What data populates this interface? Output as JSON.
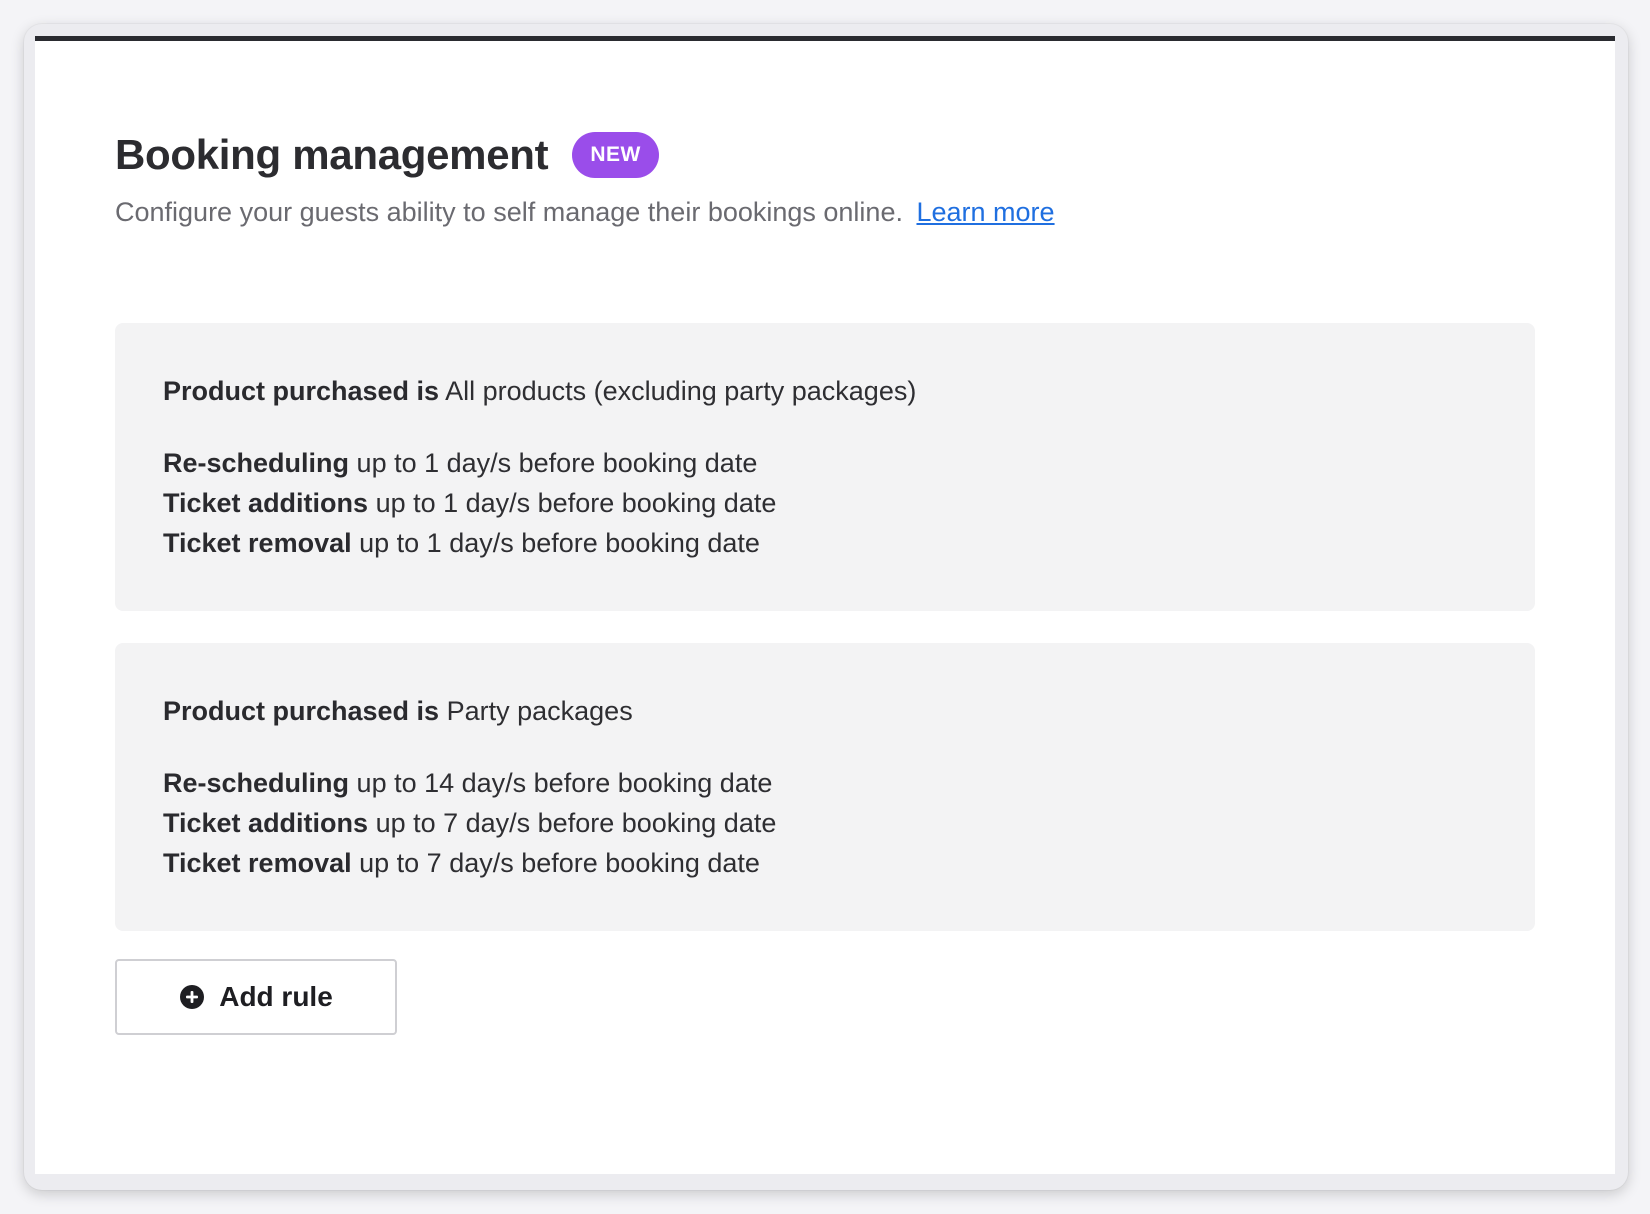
{
  "header": {
    "title": "Booking management",
    "badge": "NEW",
    "subtitle": "Configure your guests ability to self manage their bookings online.",
    "learn_more": "Learn more"
  },
  "rules": [
    {
      "product_label": "Product purchased is",
      "product_value": "All products (excluding party packages)",
      "lines": [
        {
          "label": "Re-scheduling",
          "text": "up to 1 day/s before booking date"
        },
        {
          "label": "Ticket additions",
          "text": "up to 1 day/s before booking date"
        },
        {
          "label": "Ticket removal",
          "text": "up to 1 day/s before booking date"
        }
      ]
    },
    {
      "product_label": "Product purchased is",
      "product_value": "Party packages",
      "lines": [
        {
          "label": "Re-scheduling",
          "text": "up to 14 day/s before booking date"
        },
        {
          "label": "Ticket additions",
          "text": "up to 7 day/s before booking date"
        },
        {
          "label": "Ticket removal",
          "text": "up to 7 day/s before booking date"
        }
      ]
    }
  ],
  "add_rule": {
    "label": "Add rule",
    "icon": "plus-circle-icon"
  },
  "colors": {
    "badge": "#9a4dea",
    "link": "#1f6fe0",
    "card_bg": "#f3f3f4",
    "top_border": "#2a2b30"
  }
}
